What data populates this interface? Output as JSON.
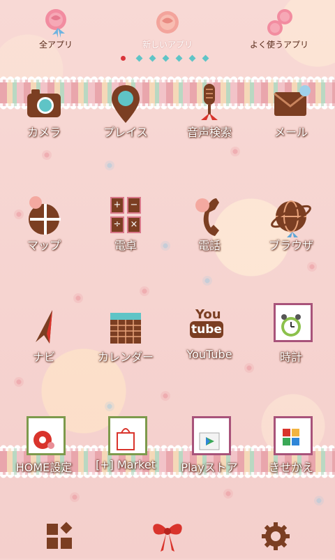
{
  "tabs": [
    {
      "label": "全アプリ",
      "icon": "rose-icon"
    },
    {
      "label": "新しいアプリ",
      "icon": "rose-icon"
    },
    {
      "label": "よく使うアプリ",
      "icon": "roses-icon"
    }
  ],
  "colors": {
    "background": "#f6d3d0",
    "brown": "#7b3e22",
    "teal": "#5fc4c6",
    "label_shadow": "#6b3b2c"
  },
  "apps": [
    {
      "label": "カメラ",
      "icon": "camera-icon"
    },
    {
      "label": "プレイス",
      "icon": "map-pin-icon"
    },
    {
      "label": "音声検索",
      "icon": "microphone-icon"
    },
    {
      "label": "メール",
      "icon": "envelope-icon"
    },
    {
      "label": "マップ",
      "icon": "map-icon"
    },
    {
      "label": "電卓",
      "icon": "calculator-icon"
    },
    {
      "label": "電話",
      "icon": "phone-icon"
    },
    {
      "label": "ブラウザ",
      "icon": "globe-icon"
    },
    {
      "label": "ナビ",
      "icon": "navigation-arrow-icon"
    },
    {
      "label": "カレンダー",
      "icon": "calendar-icon"
    },
    {
      "label": "YouTube",
      "icon": "youtube-icon",
      "icon_text_1": "You",
      "icon_text_2": "tube"
    },
    {
      "label": "時計",
      "icon": "alarm-clock-icon"
    }
  ],
  "shortcuts": [
    {
      "label": "HOME設定",
      "icon": "gear-flower-icon"
    },
    {
      "label": "[+] Market",
      "icon": "shopping-bag-icon"
    },
    {
      "label": "Playストア",
      "icon": "play-store-icon"
    },
    {
      "label": "きせかえ",
      "icon": "theme-icon"
    }
  ],
  "calculator_symbols": [
    "+",
    "−",
    "÷",
    "×"
  ],
  "dock": [
    {
      "icon": "apps-grid-icon"
    },
    {
      "icon": "ribbon-bow-icon"
    },
    {
      "icon": "settings-gear-icon"
    }
  ]
}
